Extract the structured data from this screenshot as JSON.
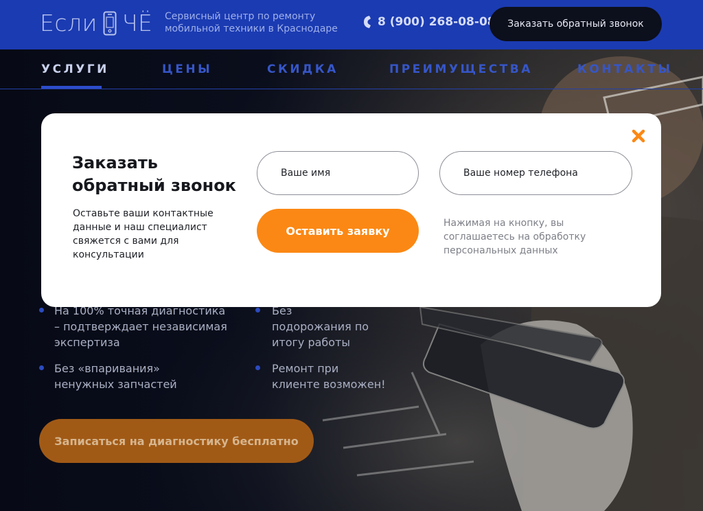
{
  "header": {
    "logo_left": "Если",
    "logo_right": "ЧЁ",
    "tagline": "Сервисный центр по ремонту мобильной техники в Краснодаре",
    "phone": "8 (900) 268-08-08",
    "callback_button": "Заказать обратный звонок"
  },
  "nav": {
    "items": [
      {
        "label": "УСЛУГИ",
        "active": true
      },
      {
        "label": "ЦЕНЫ",
        "active": false
      },
      {
        "label": "СКИДКА",
        "active": false
      },
      {
        "label": "ПРЕИМУЩЕСТВА",
        "active": false
      },
      {
        "label": "КОНТАКТЫ",
        "active": false
      }
    ]
  },
  "features": {
    "item1": "На 100% точная диагностика – подтверждает независимая экспертиза",
    "item2": "Без подорожания по итогу работы",
    "item3": "Без «впаривания» ненужных запчастей",
    "item4": "Ремонт при клиенте возможен!"
  },
  "cta_button": "Записаться на диагностику бесплатно",
  "modal": {
    "title": "Заказать обратный звонок",
    "description": "Оставьте ваши контактные данные и наш специалист свяжется с вами для консультации",
    "name_placeholder": "Ваше имя",
    "phone_placeholder": "Ваше номер телефона",
    "submit_button": "Оставить заявку",
    "consent": "Нажимая на кнопку, вы соглашаетесь на обработку персональных данных",
    "close_icon": "close-icon"
  },
  "colors": {
    "header_bg": "#1b3bb2",
    "accent_orange": "#fb8814",
    "nav_blue": "#3656c8",
    "dark_button": "#0c0f1c"
  }
}
